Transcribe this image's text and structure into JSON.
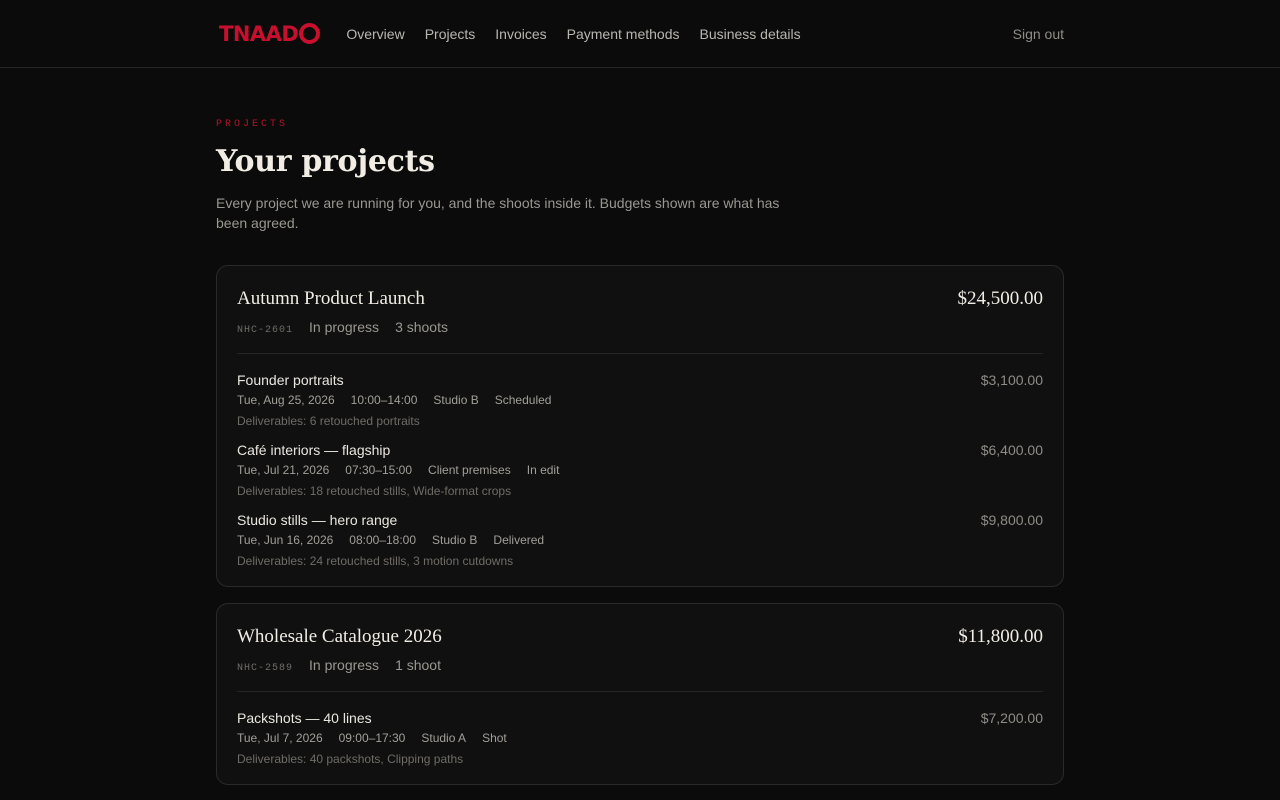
{
  "brand": {
    "logo_text": "TNAAD",
    "logo_ring": "O",
    "accent": "#c8102e"
  },
  "nav": {
    "items": [
      "Overview",
      "Projects",
      "Invoices",
      "Payment methods",
      "Business details"
    ],
    "sign_out": "Sign out"
  },
  "page": {
    "eyebrow": "PROJECTS",
    "title": "Your projects",
    "lead": "Every project we are running for you, and the shoots inside it. Budgets shown are what has been agreed."
  },
  "projects": [
    {
      "title": "Autumn Product Launch",
      "total": "$24,500.00",
      "code": "NHC-2601",
      "status": "In progress",
      "shoot_count": "3 shoots",
      "shoots": [
        {
          "name": "Founder portraits",
          "date": "Tue, Aug 25, 2026",
          "time": "10:00–14:00",
          "location": "Studio B",
          "status": "Scheduled",
          "deliverables": "Deliverables: 6 retouched portraits",
          "amount": "$3,100.00"
        },
        {
          "name": "Café interiors — flagship",
          "date": "Tue, Jul 21, 2026",
          "time": "07:30–15:00",
          "location": "Client premises",
          "status": "In edit",
          "deliverables": "Deliverables: 18 retouched stills, Wide-format crops",
          "amount": "$6,400.00"
        },
        {
          "name": "Studio stills — hero range",
          "date": "Tue, Jun 16, 2026",
          "time": "08:00–18:00",
          "location": "Studio B",
          "status": "Delivered",
          "deliverables": "Deliverables: 24 retouched stills, 3 motion cutdowns",
          "amount": "$9,800.00"
        }
      ]
    },
    {
      "title": "Wholesale Catalogue 2026",
      "total": "$11,800.00",
      "code": "NHC-2589",
      "status": "In progress",
      "shoot_count": "1 shoot",
      "shoots": [
        {
          "name": "Packshots — 40 lines",
          "date": "Tue, Jul 7, 2026",
          "time": "09:00–17:30",
          "location": "Studio A",
          "status": "Shot",
          "deliverables": "Deliverables: 40 packshots, Clipping paths",
          "amount": "$7,200.00"
        }
      ]
    }
  ]
}
